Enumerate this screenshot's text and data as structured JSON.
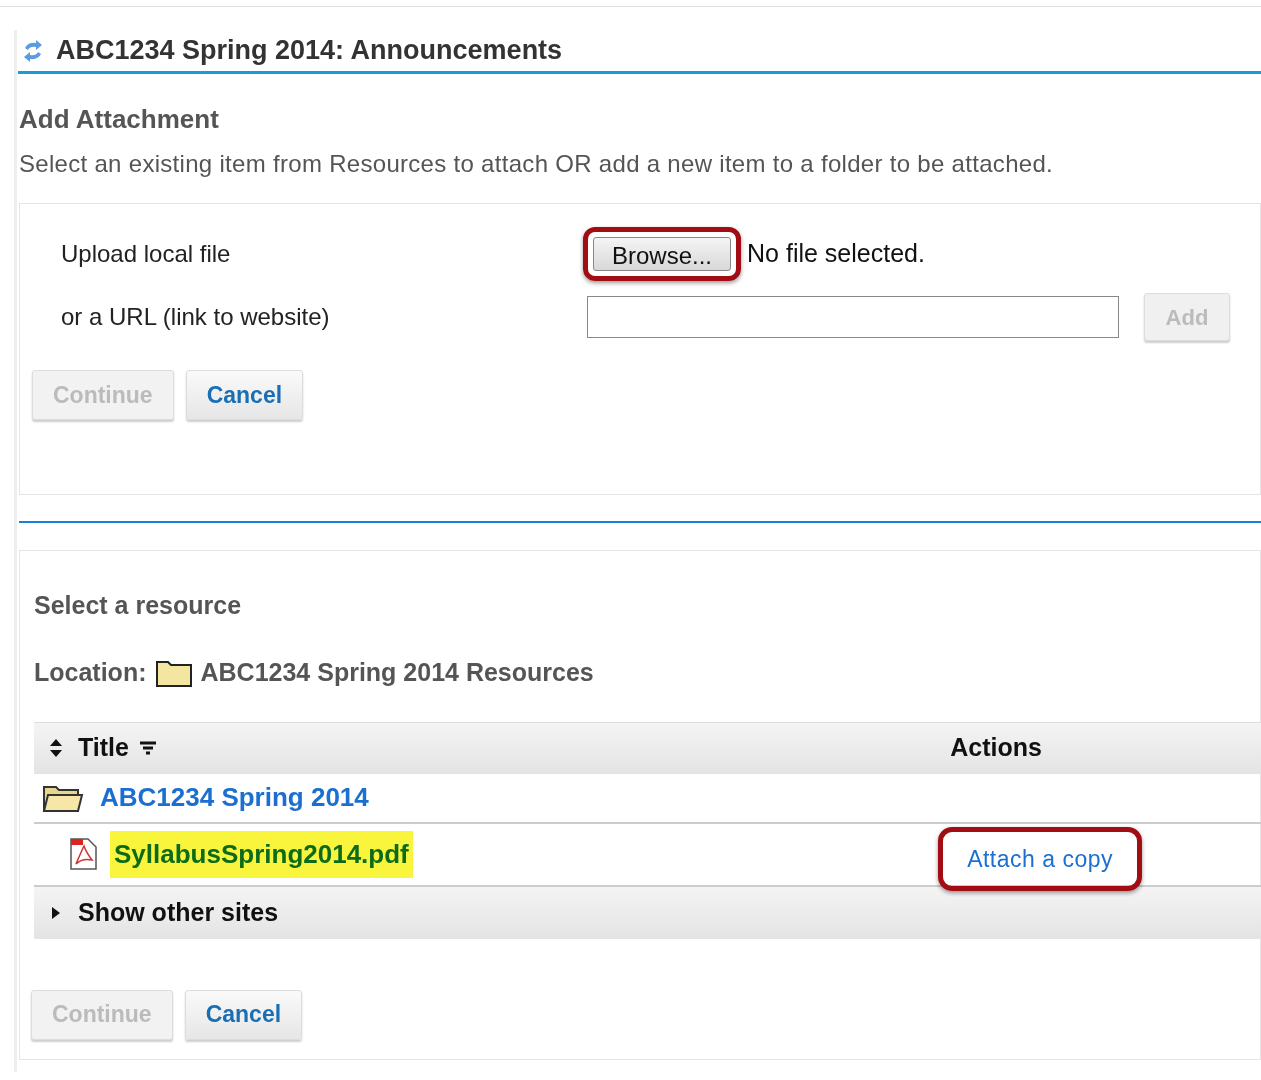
{
  "page_title": "ABC1234 Spring 2014: Announcements",
  "section": {
    "heading": "Add Attachment",
    "description": "Select an existing item from Resources to attach OR add a new item to a folder to be attached."
  },
  "upload": {
    "label": "Upload local file",
    "browse_button": {
      "label": "Browse...",
      "highlighted": true
    },
    "file_status": "No file selected.",
    "url_label": "or a URL (link to website)",
    "add_button": {
      "label": "Add",
      "disabled": true
    }
  },
  "buttons_top": [
    {
      "label": "Continue",
      "disabled": true
    },
    {
      "label": "Cancel",
      "disabled": false
    }
  ],
  "resource": {
    "heading": "Select a resource",
    "location_label": "Location:",
    "location": "ABC1234 Spring 2014 Resources"
  },
  "table": {
    "columns": [
      "Title",
      "Actions"
    ],
    "rows": [
      {
        "kind": "folder",
        "title": "ABC1234 Spring 2014",
        "highlighted": false
      },
      {
        "kind": "file",
        "title": "SyllabusSpring2014.pdf",
        "highlighted": true,
        "action": {
          "label": "Attach a copy",
          "highlighted": true
        }
      }
    ],
    "footer": {
      "label": "Show other sites",
      "expanded": false
    }
  },
  "buttons_bottom": [
    {
      "label": "Continue",
      "disabled": true
    },
    {
      "label": "Cancel",
      "disabled": false
    }
  ]
}
